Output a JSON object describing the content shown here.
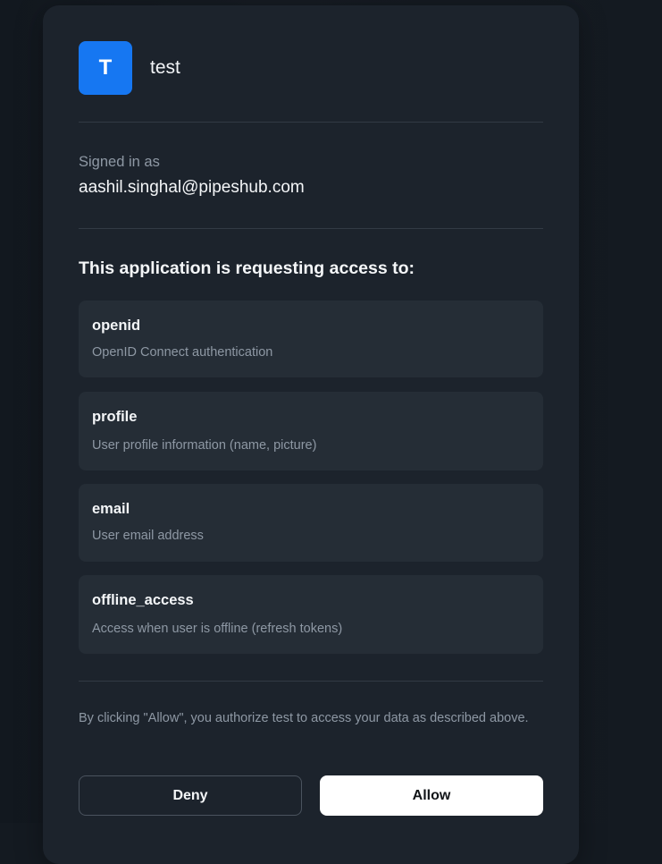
{
  "app": {
    "avatar_letter": "T",
    "name": "test",
    "avatar_color": "#1677f2"
  },
  "account": {
    "signed_in_label": "Signed in as",
    "email": "aashil.singhal@pipeshub.com"
  },
  "request": {
    "heading": "This application is requesting access to:",
    "scopes": [
      {
        "name": "openid",
        "description": "OpenID Connect authentication"
      },
      {
        "name": "profile",
        "description": "User profile information (name, picture)"
      },
      {
        "name": "email",
        "description": "User email address"
      },
      {
        "name": "offline_access",
        "description": "Access when user is offline (refresh tokens)"
      }
    ]
  },
  "consent_note": "By clicking \"Allow\", you authorize test to access your data as described above.",
  "actions": {
    "deny_label": "Deny",
    "allow_label": "Allow"
  },
  "colors": {
    "background": "#141a21",
    "card": "#1c232c",
    "scope_card": "#252d36",
    "muted_text": "#8e98a4",
    "primary_text": "#f4f6f8"
  }
}
